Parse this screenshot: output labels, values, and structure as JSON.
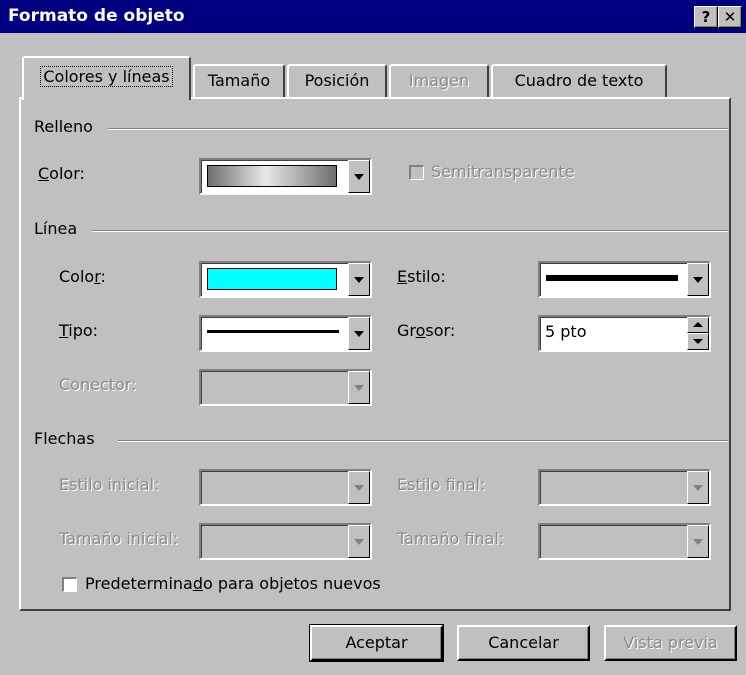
{
  "window": {
    "title": "Formato de objeto",
    "help_button": "?",
    "close_button": "✕"
  },
  "tabs": [
    {
      "label": "Colores y líneas",
      "state": "active"
    },
    {
      "label": "Tamaño",
      "state": "normal"
    },
    {
      "label": "Posición",
      "state": "normal"
    },
    {
      "label": "Imagen",
      "state": "disabled"
    },
    {
      "label": "Cuadro de texto",
      "state": "normal"
    }
  ],
  "relleno": {
    "section_label": "Relleno",
    "color_label": "Color:",
    "color_value": "gradient-gray",
    "semitransparente_label": "Semitransparente",
    "semitransparente_checked": false
  },
  "linea": {
    "section_label": "Línea",
    "color_label": "Color:",
    "color_value": "#00ffff",
    "estilo_label": "Estilo:",
    "estilo_value": "thick-solid-line",
    "tipo_label": "Tipo:",
    "tipo_value": "solid-line",
    "grosor_label": "Grosor:",
    "grosor_value": "5 pto",
    "conector_label": "Conector:"
  },
  "flechas": {
    "section_label": "Flechas",
    "estilo_inicial_label": "Estilo inicial:",
    "estilo_final_label": "Estilo final:",
    "tamano_inicial_label": "Tamaño inicial:",
    "tamano_final_label": "Tamaño final:"
  },
  "default_checkbox": {
    "label": "Predeterminado para objetos nuevos",
    "checked": false
  },
  "buttons": {
    "ok": "Aceptar",
    "cancel": "Cancelar",
    "preview": "Vista previa"
  }
}
